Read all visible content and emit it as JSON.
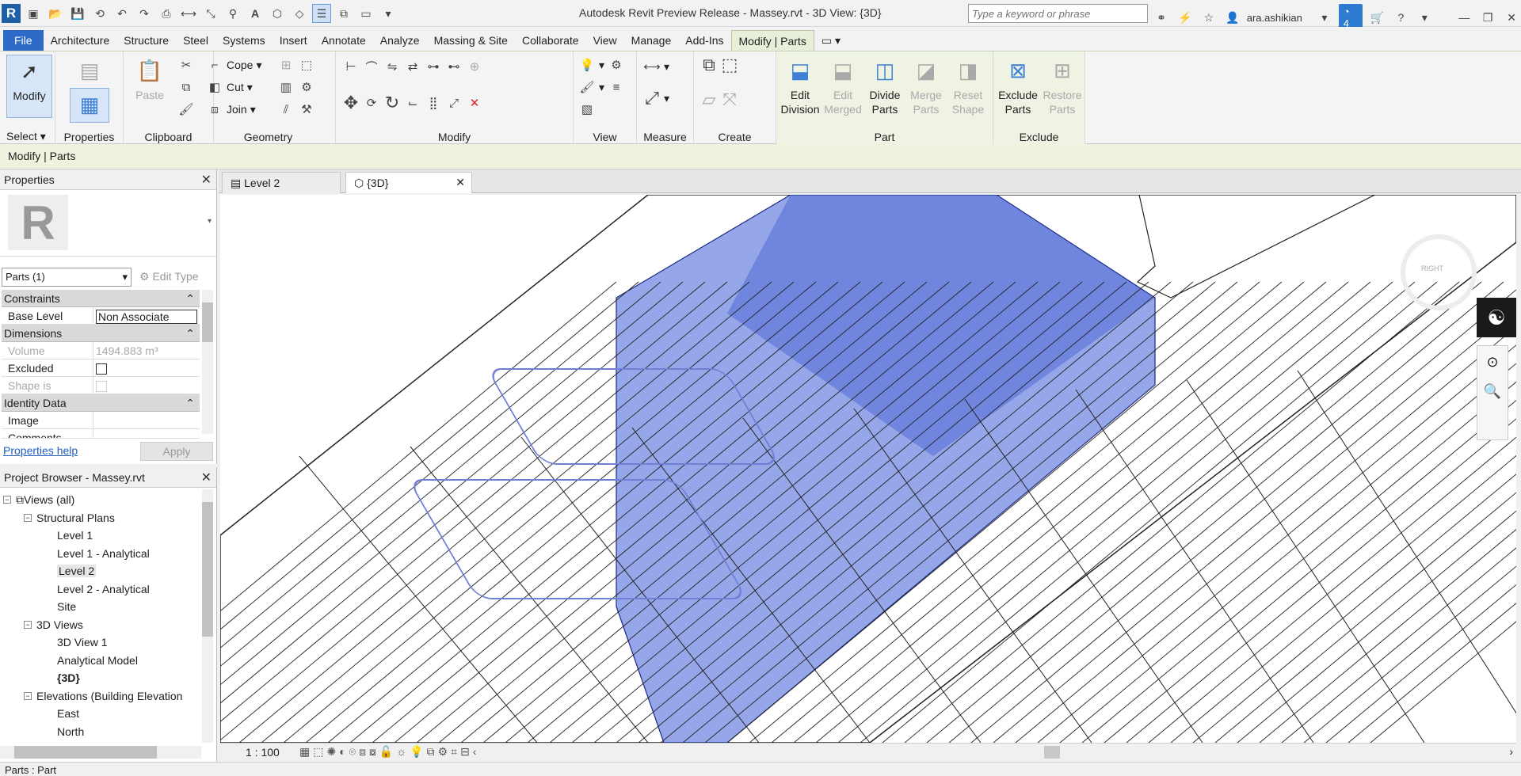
{
  "titlebar": {
    "title": "Autodesk Revit Preview Release - Massey.rvt - 3D View: {3D}",
    "search_placeholder": "Type a keyword or phrase",
    "user": "ara.ashikian",
    "notif_count": "4"
  },
  "tabs": [
    "File",
    "Architecture",
    "Structure",
    "Steel",
    "Systems",
    "Insert",
    "Annotate",
    "Analyze",
    "Massing & Site",
    "Collaborate",
    "View",
    "Manage",
    "Add-Ins",
    "Modify | Parts"
  ],
  "ribbon": {
    "modify_label": "Modify",
    "select_label": "Select",
    "properties_label": "Properties",
    "paste_label": "Paste",
    "clipboard_label": "Clipboard",
    "cope_label": "Cope",
    "cut_label": "Cut",
    "join_label": "Join",
    "geometry_label": "Geometry",
    "modify_panel_label": "Modify",
    "view_label": "View",
    "measure_label": "Measure",
    "create_label": "Create",
    "edit_division": "Edit\nDivision",
    "edit_merged": "Edit\nMerged",
    "divide_parts": "Divide\nParts",
    "merge_parts": "Merge\nParts",
    "reset_shape": "Reset\nShape",
    "exclude_parts": "Exclude\nParts",
    "restore_parts": "Restore\nParts",
    "part_label": "Part",
    "exclude_label": "Exclude"
  },
  "context_bar": "Modify | Parts",
  "properties": {
    "title": "Properties",
    "type_selector": "Parts (1)",
    "edit_type": "Edit Type",
    "sections": [
      {
        "name": "Constraints",
        "rows": [
          {
            "k": "Base Level",
            "v": "Non Associate"
          }
        ]
      },
      {
        "name": "Dimensions",
        "rows": [
          {
            "k": "Volume",
            "v": "1494.883 m³"
          },
          {
            "k": "Excluded",
            "v": ""
          },
          {
            "k": "Shape is modi...",
            "v": ""
          }
        ]
      },
      {
        "name": "Identity Data",
        "rows": [
          {
            "k": "Image",
            "v": ""
          },
          {
            "k": "Comments",
            "v": ""
          }
        ]
      }
    ],
    "help_link": "Properties help",
    "apply": "Apply"
  },
  "browser": {
    "title": "Project Browser - Massey.rvt",
    "items": [
      {
        "label": "Views (all)",
        "level": 0,
        "toggle": "-"
      },
      {
        "label": "Structural Plans",
        "level": 1,
        "toggle": "-"
      },
      {
        "label": "Level 1",
        "level": 2,
        "toggle": ""
      },
      {
        "label": "Level 1 - Analytical",
        "level": 2,
        "toggle": ""
      },
      {
        "label": "Level 2",
        "level": 2,
        "toggle": "",
        "selected": true
      },
      {
        "label": "Level 2 - Analytical",
        "level": 2,
        "toggle": ""
      },
      {
        "label": "Site",
        "level": 2,
        "toggle": ""
      },
      {
        "label": "3D Views",
        "level": 1,
        "toggle": "-"
      },
      {
        "label": "3D View 1",
        "level": 2,
        "toggle": ""
      },
      {
        "label": "Analytical Model",
        "level": 2,
        "toggle": ""
      },
      {
        "label": "{3D}",
        "level": 2,
        "toggle": "",
        "bold": true
      },
      {
        "label": "Elevations (Building Elevation",
        "level": 1,
        "toggle": "-"
      },
      {
        "label": "East",
        "level": 2,
        "toggle": ""
      },
      {
        "label": "North",
        "level": 2,
        "toggle": ""
      }
    ]
  },
  "view_tabs": [
    {
      "label": "Level 2"
    },
    {
      "label": "{3D}"
    }
  ],
  "view_control": {
    "scale": "1 : 100"
  },
  "status": {
    "text": "Parts : Part"
  }
}
